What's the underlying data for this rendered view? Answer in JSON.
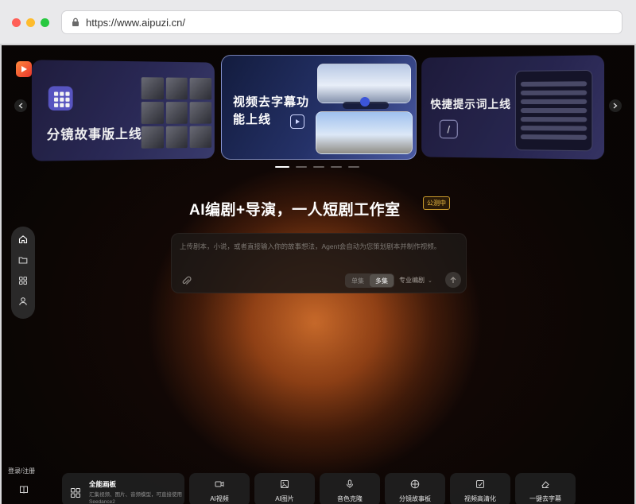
{
  "browser": {
    "url": "https://www.aipuzi.cn/"
  },
  "carousel": {
    "slides": [
      {
        "title": "分镜故事版上线"
      },
      {
        "title": "视频去字幕功能上线"
      },
      {
        "title": "快捷提示词上线"
      }
    ],
    "active_index": 0,
    "dot_count": 5
  },
  "hero": {
    "headline": "AI编剧+导演，一人短剧工作室",
    "badge": "公测中"
  },
  "prompt": {
    "placeholder": "上传剧本，小说，或者直接输入你的故事想法，Agent会自动为您策划剧本并制作视频。",
    "toggle": {
      "single": "单集",
      "multi": "多集",
      "selected": "多集"
    },
    "mode_label": "专业编剧"
  },
  "sidebar": {
    "items": [
      {
        "icon": "home-icon"
      },
      {
        "icon": "folder-icon"
      },
      {
        "icon": "apps-icon"
      },
      {
        "icon": "user-icon"
      }
    ],
    "login_label": "登录/注册"
  },
  "tools": {
    "canvas": {
      "title": "全能画板",
      "description": "汇集视频、图片、音频模型，可直接使用Seedance2"
    },
    "items": [
      {
        "label": "AI视频",
        "icon": "video-icon"
      },
      {
        "label": "AI图片",
        "icon": "image-icon"
      },
      {
        "label": "音色克隆",
        "icon": "mic-icon"
      },
      {
        "label": "分镜故事板",
        "icon": "grid-icon"
      },
      {
        "label": "视频高清化",
        "icon": "enhance-icon"
      },
      {
        "label": "一键去字幕",
        "icon": "eraser-icon"
      }
    ]
  },
  "colors": {
    "accent_orange": "#c7692a",
    "badge_gold": "#f2c043",
    "background": "#0c0706"
  }
}
